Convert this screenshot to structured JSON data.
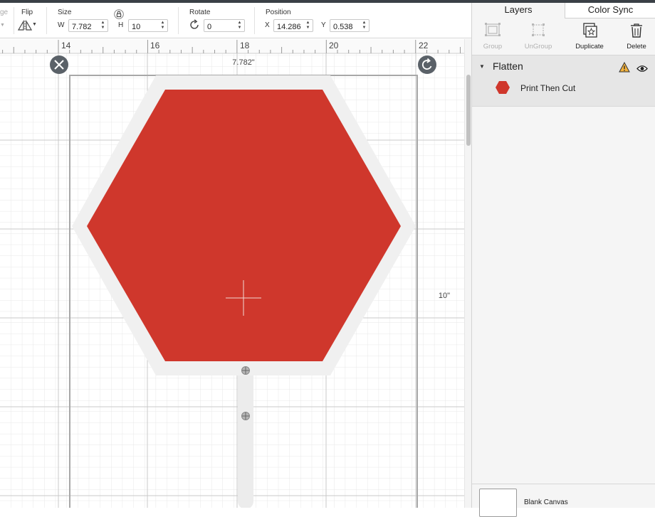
{
  "toolbar": {
    "cut_label": "ge",
    "flip": {
      "label": "Flip"
    },
    "size": {
      "label": "Size",
      "w_label": "W",
      "w_value": "7.782",
      "h_label": "H",
      "h_value": "10"
    },
    "rotate": {
      "label": "Rotate",
      "value": "0"
    },
    "position": {
      "label": "Position",
      "x_label": "X",
      "x_value": "14.286",
      "y_label": "Y",
      "y_value": "0.538"
    }
  },
  "canvas": {
    "ruler_ticks": [
      "14",
      "16",
      "18",
      "20",
      "22"
    ],
    "width_dim": "7.782\"",
    "height_dim": "10\"",
    "shape_color": "#cf372c",
    "offset_color": "#f0f0f0"
  },
  "panel": {
    "tabs": {
      "layers": "Layers",
      "color_sync": "Color Sync"
    },
    "actions": {
      "group": "Group",
      "ungroup": "UnGroup",
      "duplicate": "Duplicate",
      "delete": "Delete"
    },
    "layer_group": {
      "name": "Flatten"
    },
    "layer_item": {
      "name": "Print Then Cut"
    },
    "bottom": {
      "label": "Blank Canvas"
    }
  }
}
